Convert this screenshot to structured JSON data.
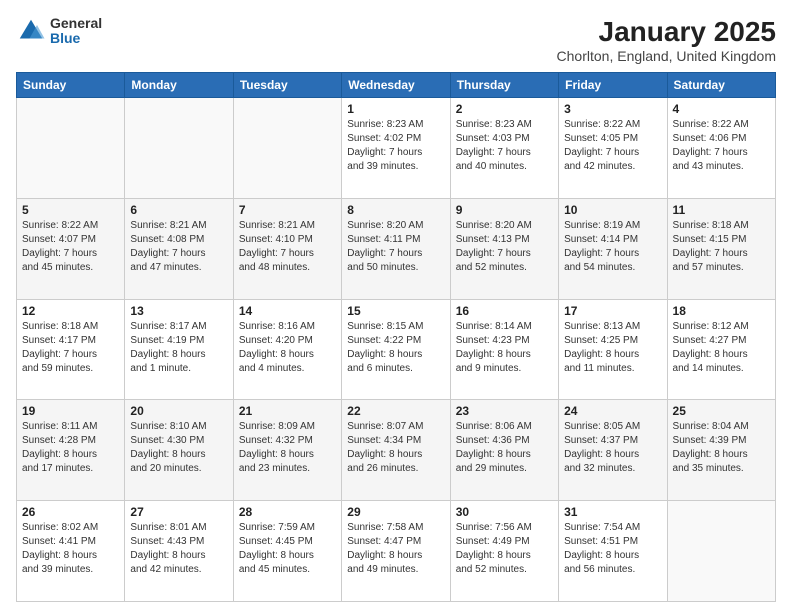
{
  "logo": {
    "general": "General",
    "blue": "Blue"
  },
  "title": "January 2025",
  "location": "Chorlton, England, United Kingdom",
  "days_of_week": [
    "Sunday",
    "Monday",
    "Tuesday",
    "Wednesday",
    "Thursday",
    "Friday",
    "Saturday"
  ],
  "weeks": [
    [
      {
        "day": "",
        "info": ""
      },
      {
        "day": "",
        "info": ""
      },
      {
        "day": "",
        "info": ""
      },
      {
        "day": "1",
        "info": "Sunrise: 8:23 AM\nSunset: 4:02 PM\nDaylight: 7 hours\nand 39 minutes."
      },
      {
        "day": "2",
        "info": "Sunrise: 8:23 AM\nSunset: 4:03 PM\nDaylight: 7 hours\nand 40 minutes."
      },
      {
        "day": "3",
        "info": "Sunrise: 8:22 AM\nSunset: 4:05 PM\nDaylight: 7 hours\nand 42 minutes."
      },
      {
        "day": "4",
        "info": "Sunrise: 8:22 AM\nSunset: 4:06 PM\nDaylight: 7 hours\nand 43 minutes."
      }
    ],
    [
      {
        "day": "5",
        "info": "Sunrise: 8:22 AM\nSunset: 4:07 PM\nDaylight: 7 hours\nand 45 minutes."
      },
      {
        "day": "6",
        "info": "Sunrise: 8:21 AM\nSunset: 4:08 PM\nDaylight: 7 hours\nand 47 minutes."
      },
      {
        "day": "7",
        "info": "Sunrise: 8:21 AM\nSunset: 4:10 PM\nDaylight: 7 hours\nand 48 minutes."
      },
      {
        "day": "8",
        "info": "Sunrise: 8:20 AM\nSunset: 4:11 PM\nDaylight: 7 hours\nand 50 minutes."
      },
      {
        "day": "9",
        "info": "Sunrise: 8:20 AM\nSunset: 4:13 PM\nDaylight: 7 hours\nand 52 minutes."
      },
      {
        "day": "10",
        "info": "Sunrise: 8:19 AM\nSunset: 4:14 PM\nDaylight: 7 hours\nand 54 minutes."
      },
      {
        "day": "11",
        "info": "Sunrise: 8:18 AM\nSunset: 4:15 PM\nDaylight: 7 hours\nand 57 minutes."
      }
    ],
    [
      {
        "day": "12",
        "info": "Sunrise: 8:18 AM\nSunset: 4:17 PM\nDaylight: 7 hours\nand 59 minutes."
      },
      {
        "day": "13",
        "info": "Sunrise: 8:17 AM\nSunset: 4:19 PM\nDaylight: 8 hours\nand 1 minute."
      },
      {
        "day": "14",
        "info": "Sunrise: 8:16 AM\nSunset: 4:20 PM\nDaylight: 8 hours\nand 4 minutes."
      },
      {
        "day": "15",
        "info": "Sunrise: 8:15 AM\nSunset: 4:22 PM\nDaylight: 8 hours\nand 6 minutes."
      },
      {
        "day": "16",
        "info": "Sunrise: 8:14 AM\nSunset: 4:23 PM\nDaylight: 8 hours\nand 9 minutes."
      },
      {
        "day": "17",
        "info": "Sunrise: 8:13 AM\nSunset: 4:25 PM\nDaylight: 8 hours\nand 11 minutes."
      },
      {
        "day": "18",
        "info": "Sunrise: 8:12 AM\nSunset: 4:27 PM\nDaylight: 8 hours\nand 14 minutes."
      }
    ],
    [
      {
        "day": "19",
        "info": "Sunrise: 8:11 AM\nSunset: 4:28 PM\nDaylight: 8 hours\nand 17 minutes."
      },
      {
        "day": "20",
        "info": "Sunrise: 8:10 AM\nSunset: 4:30 PM\nDaylight: 8 hours\nand 20 minutes."
      },
      {
        "day": "21",
        "info": "Sunrise: 8:09 AM\nSunset: 4:32 PM\nDaylight: 8 hours\nand 23 minutes."
      },
      {
        "day": "22",
        "info": "Sunrise: 8:07 AM\nSunset: 4:34 PM\nDaylight: 8 hours\nand 26 minutes."
      },
      {
        "day": "23",
        "info": "Sunrise: 8:06 AM\nSunset: 4:36 PM\nDaylight: 8 hours\nand 29 minutes."
      },
      {
        "day": "24",
        "info": "Sunrise: 8:05 AM\nSunset: 4:37 PM\nDaylight: 8 hours\nand 32 minutes."
      },
      {
        "day": "25",
        "info": "Sunrise: 8:04 AM\nSunset: 4:39 PM\nDaylight: 8 hours\nand 35 minutes."
      }
    ],
    [
      {
        "day": "26",
        "info": "Sunrise: 8:02 AM\nSunset: 4:41 PM\nDaylight: 8 hours\nand 39 minutes."
      },
      {
        "day": "27",
        "info": "Sunrise: 8:01 AM\nSunset: 4:43 PM\nDaylight: 8 hours\nand 42 minutes."
      },
      {
        "day": "28",
        "info": "Sunrise: 7:59 AM\nSunset: 4:45 PM\nDaylight: 8 hours\nand 45 minutes."
      },
      {
        "day": "29",
        "info": "Sunrise: 7:58 AM\nSunset: 4:47 PM\nDaylight: 8 hours\nand 49 minutes."
      },
      {
        "day": "30",
        "info": "Sunrise: 7:56 AM\nSunset: 4:49 PM\nDaylight: 8 hours\nand 52 minutes."
      },
      {
        "day": "31",
        "info": "Sunrise: 7:54 AM\nSunset: 4:51 PM\nDaylight: 8 hours\nand 56 minutes."
      },
      {
        "day": "",
        "info": ""
      }
    ]
  ]
}
